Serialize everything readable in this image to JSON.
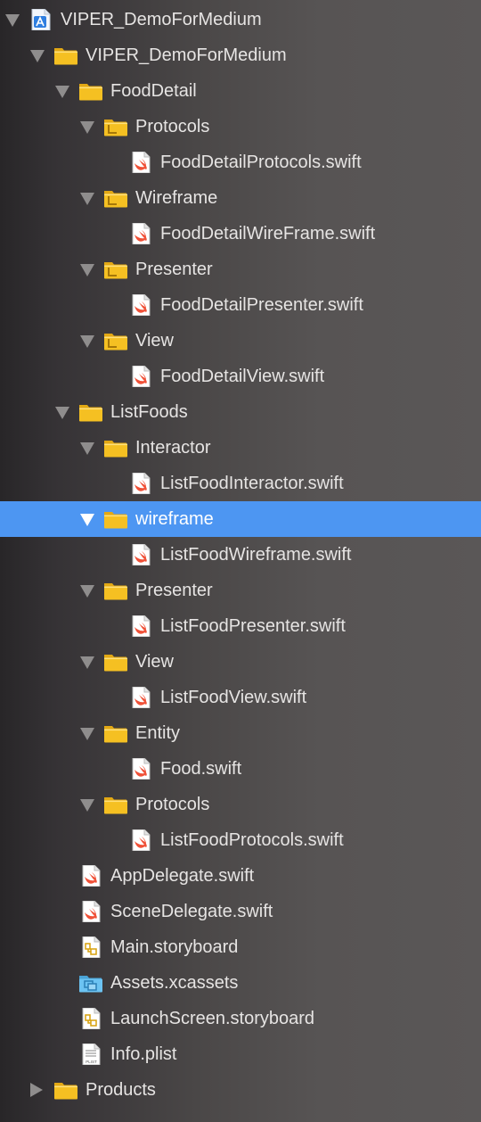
{
  "navigator": {
    "rows": [
      {
        "label": "VIPER_DemoForMedium",
        "icon": "xcode-project-icon",
        "depth": 0,
        "expanded": true
      },
      {
        "label": "VIPER_DemoForMedium",
        "icon": "folder-icon",
        "depth": 1,
        "expanded": true
      },
      {
        "label": "FoodDetail",
        "icon": "folder-icon",
        "depth": 2,
        "expanded": true
      },
      {
        "label": "Protocols",
        "icon": "folder-reference-icon",
        "depth": 3,
        "expanded": true
      },
      {
        "label": "FoodDetailProtocols.swift",
        "icon": "swift-file-icon",
        "depth": 4
      },
      {
        "label": "Wireframe",
        "icon": "folder-reference-icon",
        "depth": 3,
        "expanded": true
      },
      {
        "label": "FoodDetailWireFrame.swift",
        "icon": "swift-file-icon",
        "depth": 4
      },
      {
        "label": "Presenter",
        "icon": "folder-reference-icon",
        "depth": 3,
        "expanded": true
      },
      {
        "label": "FoodDetailPresenter.swift",
        "icon": "swift-file-icon",
        "depth": 4
      },
      {
        "label": "View",
        "icon": "folder-reference-icon",
        "depth": 3,
        "expanded": true
      },
      {
        "label": "FoodDetailView.swift",
        "icon": "swift-file-icon",
        "depth": 4
      },
      {
        "label": "ListFoods",
        "icon": "folder-icon",
        "depth": 2,
        "expanded": true
      },
      {
        "label": "Interactor",
        "icon": "folder-icon",
        "depth": 3,
        "expanded": true
      },
      {
        "label": "ListFoodInteractor.swift",
        "icon": "swift-file-icon",
        "depth": 4
      },
      {
        "label": "wireframe",
        "icon": "folder-icon",
        "depth": 3,
        "expanded": true,
        "selected": true
      },
      {
        "label": "ListFoodWireframe.swift",
        "icon": "swift-file-icon",
        "depth": 4
      },
      {
        "label": "Presenter",
        "icon": "folder-icon",
        "depth": 3,
        "expanded": true
      },
      {
        "label": "ListFoodPresenter.swift",
        "icon": "swift-file-icon",
        "depth": 4
      },
      {
        "label": "View",
        "icon": "folder-icon",
        "depth": 3,
        "expanded": true
      },
      {
        "label": "ListFoodView.swift",
        "icon": "swift-file-icon",
        "depth": 4
      },
      {
        "label": "Entity",
        "icon": "folder-icon",
        "depth": 3,
        "expanded": true
      },
      {
        "label": "Food.swift",
        "icon": "swift-file-icon",
        "depth": 4
      },
      {
        "label": "Protocols",
        "icon": "folder-icon",
        "depth": 3,
        "expanded": true
      },
      {
        "label": "ListFoodProtocols.swift",
        "icon": "swift-file-icon",
        "depth": 4
      },
      {
        "label": "AppDelegate.swift",
        "icon": "swift-file-icon",
        "depth": 2
      },
      {
        "label": "SceneDelegate.swift",
        "icon": "swift-file-icon",
        "depth": 2
      },
      {
        "label": "Main.storyboard",
        "icon": "storyboard-file-icon",
        "depth": 2
      },
      {
        "label": "Assets.xcassets",
        "icon": "asset-catalog-icon",
        "depth": 2
      },
      {
        "label": "LaunchScreen.storyboard",
        "icon": "storyboard-file-icon",
        "depth": 2
      },
      {
        "label": "Info.plist",
        "icon": "plist-file-icon",
        "plist_badge": "PLIST",
        "depth": 2
      },
      {
        "label": "Products",
        "icon": "folder-icon",
        "depth": 1,
        "expanded": false
      }
    ]
  },
  "colors": {
    "selection": "#4d96f2",
    "text": "#e6e4e3",
    "selected_text": "#ffffff",
    "disclosure": "#8f8d8d",
    "folder": "#f5c022",
    "swift": "#f05138",
    "asset_folder": "#6cc3f2",
    "project": "#2e7ee0"
  }
}
